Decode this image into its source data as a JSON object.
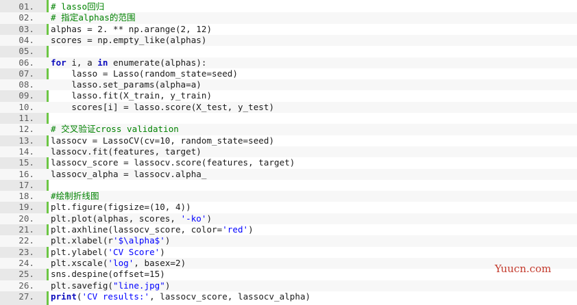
{
  "code": {
    "lines": [
      {
        "num": "01.",
        "parts": [
          {
            "t": "# lasso回归",
            "c": "cmt"
          }
        ]
      },
      {
        "num": "02.",
        "parts": [
          {
            "t": "# 指定alphas的范围",
            "c": "cmt"
          }
        ]
      },
      {
        "num": "03.",
        "parts": [
          {
            "t": "alphas = 2. ** np.arange(2, 12)",
            "c": ""
          }
        ]
      },
      {
        "num": "04.",
        "parts": [
          {
            "t": "scores = np.empty_like(alphas)",
            "c": ""
          }
        ]
      },
      {
        "num": "05.",
        "parts": []
      },
      {
        "num": "06.",
        "parts": [
          {
            "t": "for",
            "c": "kw"
          },
          {
            "t": " i, a ",
            "c": ""
          },
          {
            "t": "in",
            "c": "kw"
          },
          {
            "t": " enumerate(alphas):",
            "c": ""
          }
        ]
      },
      {
        "num": "07.",
        "parts": [
          {
            "t": "    lasso = Lasso(random_state=seed)",
            "c": ""
          }
        ]
      },
      {
        "num": "08.",
        "parts": [
          {
            "t": "    lasso.set_params(alpha=a)",
            "c": ""
          }
        ]
      },
      {
        "num": "09.",
        "parts": [
          {
            "t": "    lasso.fit(X_train, y_train)",
            "c": ""
          }
        ]
      },
      {
        "num": "10.",
        "parts": [
          {
            "t": "    scores[i] = lasso.score(X_test, y_test)",
            "c": ""
          }
        ]
      },
      {
        "num": "11.",
        "parts": []
      },
      {
        "num": "12.",
        "parts": [
          {
            "t": "# 交叉验证cross validation",
            "c": "cmt"
          }
        ]
      },
      {
        "num": "13.",
        "parts": [
          {
            "t": "lassocv = LassoCV(cv=10, random_state=seed)",
            "c": ""
          }
        ]
      },
      {
        "num": "14.",
        "parts": [
          {
            "t": "lassocv.fit(features, target)",
            "c": ""
          }
        ]
      },
      {
        "num": "15.",
        "parts": [
          {
            "t": "lassocv_score = lassocv.score(features, target)",
            "c": ""
          }
        ]
      },
      {
        "num": "16.",
        "parts": [
          {
            "t": "lassocv_alpha = lassocv.alpha_",
            "c": ""
          }
        ]
      },
      {
        "num": "17.",
        "parts": []
      },
      {
        "num": "18.",
        "parts": [
          {
            "t": "#绘制折线图",
            "c": "cmt"
          }
        ]
      },
      {
        "num": "19.",
        "parts": [
          {
            "t": "plt.figure(figsize=(10, 4))",
            "c": ""
          }
        ]
      },
      {
        "num": "20.",
        "parts": [
          {
            "t": "plt.plot(alphas, scores, ",
            "c": ""
          },
          {
            "t": "'-ko'",
            "c": "str"
          },
          {
            "t": ")",
            "c": ""
          }
        ]
      },
      {
        "num": "21.",
        "parts": [
          {
            "t": "plt.axhline(lassocv_score, color=",
            "c": ""
          },
          {
            "t": "'red'",
            "c": "str"
          },
          {
            "t": ")",
            "c": ""
          }
        ]
      },
      {
        "num": "22.",
        "parts": [
          {
            "t": "plt.xlabel(r",
            "c": ""
          },
          {
            "t": "'$\\alpha$'",
            "c": "str"
          },
          {
            "t": ")",
            "c": ""
          }
        ]
      },
      {
        "num": "23.",
        "parts": [
          {
            "t": "plt.ylabel(",
            "c": ""
          },
          {
            "t": "'CV Score'",
            "c": "str"
          },
          {
            "t": ")",
            "c": ""
          }
        ]
      },
      {
        "num": "24.",
        "parts": [
          {
            "t": "plt.xscale(",
            "c": ""
          },
          {
            "t": "'log'",
            "c": "str"
          },
          {
            "t": ", basex=2)",
            "c": ""
          }
        ]
      },
      {
        "num": "25.",
        "parts": [
          {
            "t": "sns.despine(offset=15)",
            "c": ""
          }
        ]
      },
      {
        "num": "26.",
        "parts": [
          {
            "t": "plt.savefig(",
            "c": ""
          },
          {
            "t": "\"line.jpg\"",
            "c": "str"
          },
          {
            "t": ")",
            "c": ""
          }
        ]
      },
      {
        "num": "27.",
        "parts": [
          {
            "t": "print",
            "c": "kw"
          },
          {
            "t": "(",
            "c": ""
          },
          {
            "t": "'CV results:'",
            "c": "str"
          },
          {
            "t": ", lassocv_score, lassocv_alpha)",
            "c": ""
          }
        ]
      }
    ]
  },
  "watermark": "Yuucn.com",
  "colors": {
    "gutter_border": "#6cc644",
    "comment": "#008200",
    "keyword": "#0b0bbd",
    "string": "#0000ff",
    "watermark": "#c3392b"
  }
}
